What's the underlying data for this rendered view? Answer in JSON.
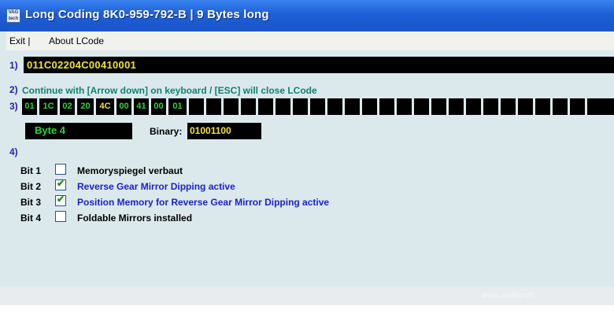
{
  "window": {
    "title": "Long Coding  8K0-959-792-B  |  9 Bytes long",
    "icon": "vag-com-app-icon"
  },
  "menu": {
    "items": [
      "Exit |",
      "About LCode"
    ]
  },
  "row1": {
    "label": "1)",
    "code": "011C02204C00410001"
  },
  "row2": {
    "label": "2)",
    "hint": "Continue with [Arrow down] on keyboard / [ESC] will close LCode"
  },
  "row3": {
    "label": "3)",
    "bytes": [
      "01",
      "1C",
      "02",
      "20",
      "4C",
      "00",
      "41",
      "00",
      "01"
    ],
    "selected_index": 4,
    "byte_label": "Byte 4",
    "binary_label": "Binary:",
    "binary_value": "01001100"
  },
  "row4": {
    "label": "4)",
    "bits": [
      {
        "bit": "Bit 1",
        "checked": false,
        "desc": "Memoryspiegel verbaut"
      },
      {
        "bit": "Bit 2",
        "checked": true,
        "desc": "Reverse Gear Mirror Dipping active"
      },
      {
        "bit": "Bit 3",
        "checked": true,
        "desc": "Position Memory for Reverse Gear Mirror Dipping active"
      },
      {
        "bit": "Bit 4",
        "checked": false,
        "desc": "Foldable Mirrors installed"
      }
    ]
  },
  "watermark": {
    "text": "Club Audispo",
    "sub": "www.audisport..."
  },
  "colors": {
    "title_bg": "#1d5fd8",
    "panel_bg": "#dce9ec",
    "code_yellow": "#f4e23a",
    "byte_green": "#2cd63a",
    "hint_teal": "#108070",
    "active_blue": "#1a22c8"
  }
}
